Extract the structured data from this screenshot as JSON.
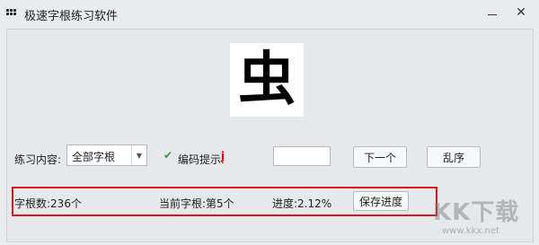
{
  "window": {
    "title": "极速字根练习软件",
    "icons": {
      "app": "grid-icon",
      "minimize": "minimize-icon",
      "close": "close-icon"
    },
    "close_glyph": "✕"
  },
  "glyph": {
    "character": "虫"
  },
  "controls": {
    "practice_label": "练习内容:",
    "practice_select": {
      "value": "全部字根"
    },
    "hint_checked": true,
    "hint_label": "编码提示:",
    "hint_value": "j",
    "code_input": {
      "value": ""
    },
    "next_button": "下一个",
    "shuffle_button": "乱序"
  },
  "status": {
    "count_text": "字根数:236个",
    "current_text": "当前字根:第5个",
    "progress_text": "进度:2.12%",
    "save_button": "保存进度"
  },
  "colors": {
    "highlight_border": "#e0131c",
    "hint_value": "#ff0000",
    "check": "#3a9a3a"
  },
  "watermark": {
    "text": "KK下载",
    "url": "www.kkx.net"
  }
}
